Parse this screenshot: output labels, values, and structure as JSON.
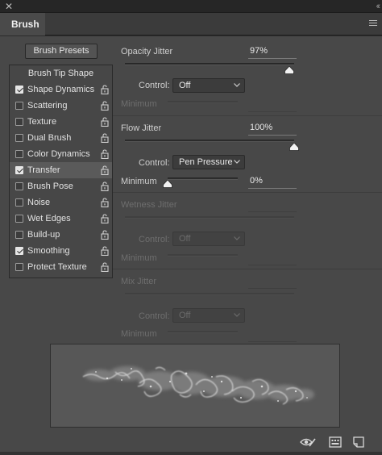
{
  "window": {
    "close_glyph": "✕",
    "collapse_glyph": "‹‹"
  },
  "tab": {
    "title": "Brush"
  },
  "presets_button": "Brush Presets",
  "brush_tip_shape": "Brush Tip Shape",
  "options": [
    {
      "label": "Shape Dynamics",
      "checked": true,
      "selected": false
    },
    {
      "label": "Scattering",
      "checked": false,
      "selected": false
    },
    {
      "label": "Texture",
      "checked": false,
      "selected": false
    },
    {
      "label": "Dual Brush",
      "checked": false,
      "selected": false
    },
    {
      "label": "Color Dynamics",
      "checked": false,
      "selected": false
    },
    {
      "label": "Transfer",
      "checked": true,
      "selected": true
    },
    {
      "label": "Brush Pose",
      "checked": false,
      "selected": false
    },
    {
      "label": "Noise",
      "checked": false,
      "selected": false
    },
    {
      "label": "Wet Edges",
      "checked": false,
      "selected": false
    },
    {
      "label": "Build-up",
      "checked": false,
      "selected": false
    },
    {
      "label": "Smoothing",
      "checked": true,
      "selected": false
    },
    {
      "label": "Protect Texture",
      "checked": false,
      "selected": false
    }
  ],
  "sections": {
    "opacity": {
      "title": "Opacity Jitter",
      "value": "97%",
      "level": 0.97,
      "control_label": "Control:",
      "control_value": "Off",
      "minimum_label": "Minimum",
      "enabled": true,
      "minimum_enabled": false
    },
    "flow": {
      "title": "Flow Jitter",
      "value": "100%",
      "level": 1.0,
      "control_label": "Control:",
      "control_value": "Pen Pressure",
      "minimum_label": "Minimum",
      "minimum_value": "0%",
      "minimum_level": 0.0,
      "enabled": true,
      "minimum_enabled": true
    },
    "wetness": {
      "title": "Wetness Jitter",
      "control_label": "Control:",
      "control_value": "Off",
      "minimum_label": "Minimum",
      "enabled": false
    },
    "mix": {
      "title": "Mix Jitter",
      "control_label": "Control:",
      "control_value": "Off",
      "minimum_label": "Minimum",
      "enabled": false
    }
  },
  "icons": {
    "close": "close-icon",
    "collapse": "collapse-icon",
    "menu": "panel-menu-icon",
    "lock": "lock-icon",
    "chevron": "chevron-down-icon",
    "toggle_preview": "eye-brush-icon",
    "open_presets": "presets-panel-icon",
    "new_preset": "new-preset-icon"
  },
  "colors": {
    "panel": "#484848",
    "selected_row": "#5a5a5a",
    "preview_bg": "#575757"
  }
}
